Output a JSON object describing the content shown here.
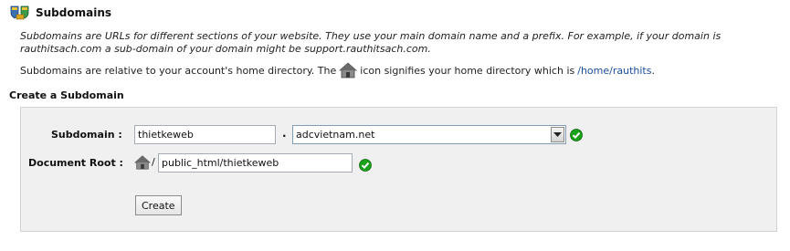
{
  "header": {
    "title": "Subdomains",
    "logo_icon": "subdomains-shield-icon"
  },
  "intro": {
    "text": "Subdomains are URLs for different sections of your website. They use your main domain name and a prefix. For example, if your domain is rauthitsach.com a sub-domain of your domain might be support.rauthitsach.com."
  },
  "relative_note": {
    "before": "Subdomains are relative to your account's home directory. The",
    "after": "icon signifies your home directory which is",
    "home_link": "/home/rauthits",
    "home_icon": "house-icon"
  },
  "create": {
    "section_title": "Create a Subdomain",
    "subdomain_label": "Subdomain :",
    "subdomain_value": "thietkeweb",
    "dot": ".",
    "domain_selected": "adcvietnam.net",
    "docroot_label": "Document Root :",
    "docroot_slash": "/",
    "docroot_value": "public_html/thietkeweb",
    "button_label": "Create",
    "valid_icon": "green-check-icon"
  },
  "colors": {
    "link": "#1a4d9c",
    "panel_bg": "#f0f0f0",
    "check_green": "#1aa01a"
  }
}
